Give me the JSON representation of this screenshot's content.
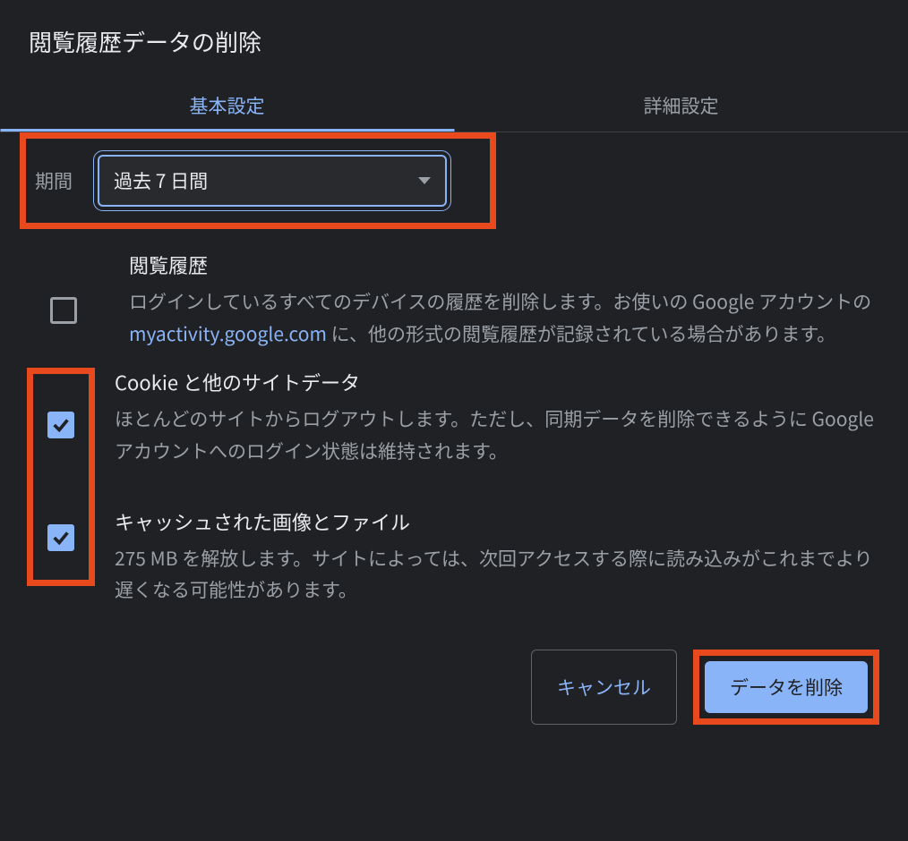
{
  "dialog": {
    "title": "閲覧履歴データの削除"
  },
  "tabs": {
    "basic": "基本設定",
    "advanced": "詳細設定"
  },
  "timeRange": {
    "label": "期間",
    "value": "過去 7 日間"
  },
  "options": {
    "history": {
      "title": "閲覧履歴",
      "desc_before": "ログインしているすべてのデバイスの履歴を削除します。お使いの Google アカウントの ",
      "link_text": "myactivity.google.com",
      "desc_after": " に、他の形式の閲覧履歴が記録されている場合があります。",
      "checked": false
    },
    "cookies": {
      "title": "Cookie と他のサイトデータ",
      "desc": "ほとんどのサイトからログアウトします。ただし、同期データを削除できるように Google アカウントへのログイン状態は維持されます。",
      "checked": true
    },
    "cache": {
      "title": "キャッシュされた画像とファイル",
      "desc": "275 MB を解放します。サイトによっては、次回アクセスする際に読み込みがこれまでより遅くなる可能性があります。",
      "checked": true
    }
  },
  "footer": {
    "cancel": "キャンセル",
    "confirm": "データを削除"
  }
}
